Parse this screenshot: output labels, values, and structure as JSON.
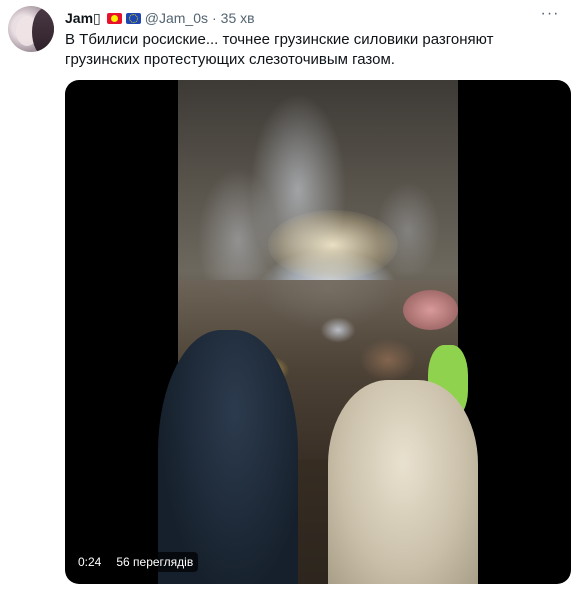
{
  "tweet": {
    "author_name": "Jam",
    "author_name_glyph": "▯",
    "handle": "@Jam_0s",
    "separator": "·",
    "time": "35 хв",
    "text": "В Тбилиси росиские... точнее грузинские силовики разгоняют грузинских протестующих слезоточивым газом.",
    "more_glyph": "···",
    "flags": [
      "kyrgyzstan-flag-icon",
      "eu-flag-icon"
    ]
  },
  "media": {
    "duration": "0:24",
    "views": "56 переглядів"
  }
}
